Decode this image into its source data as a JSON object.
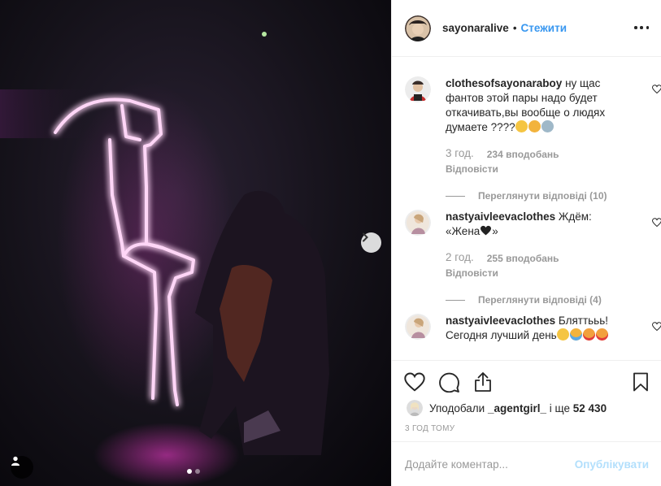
{
  "header": {
    "username": "sayonaralive",
    "separator": "•",
    "follow_label": "Стежити"
  },
  "comments": [
    {
      "username": "clothesofsayonaraboy",
      "text": "ну щас фантов этой пары надо будет откачивать,вы вообще о людях думаете ????",
      "emojis": [
        "confused-face-emoji",
        "frowning-face-emoji",
        "anxious-face-emoji"
      ],
      "time": "3 год.",
      "likes": "234 вподобань",
      "reply_label": "Відповісти",
      "view_replies": "Переглянути відповіді (10)"
    },
    {
      "username": "nastyaivleevaclothes",
      "text": "Ждём: «Жена",
      "text_after_emoji": "»",
      "emojis": [
        "black-heart-emoji"
      ],
      "time": "2 год.",
      "likes": "255 вподобань",
      "reply_label": "Відповісти",
      "view_replies": "Переглянути відповіді (4)"
    },
    {
      "username": "nastyaivleevaclothes",
      "text": "Бляттььь! Сегодня лучший день",
      "emojis": [
        "smiling-face-emoji",
        "crying-face-emoji",
        "heart-eyes-cat-emoji",
        "heart-eyes-cat-emoji"
      ]
    }
  ],
  "likes_line": {
    "prefix": "Уподобали",
    "user": "_agentgirl_",
    "middle": "і ще",
    "count": "52 430"
  },
  "posted_time": "3 ГОД ТОМУ",
  "add_comment": {
    "placeholder": "Додайте коментар...",
    "publish_label": "Опублікувати"
  },
  "colors": {
    "accent": "#3897f0",
    "publish_disabled": "#b2dffc",
    "neon": "#ff4fe0"
  },
  "carousel": {
    "current": 1,
    "total": 2
  }
}
